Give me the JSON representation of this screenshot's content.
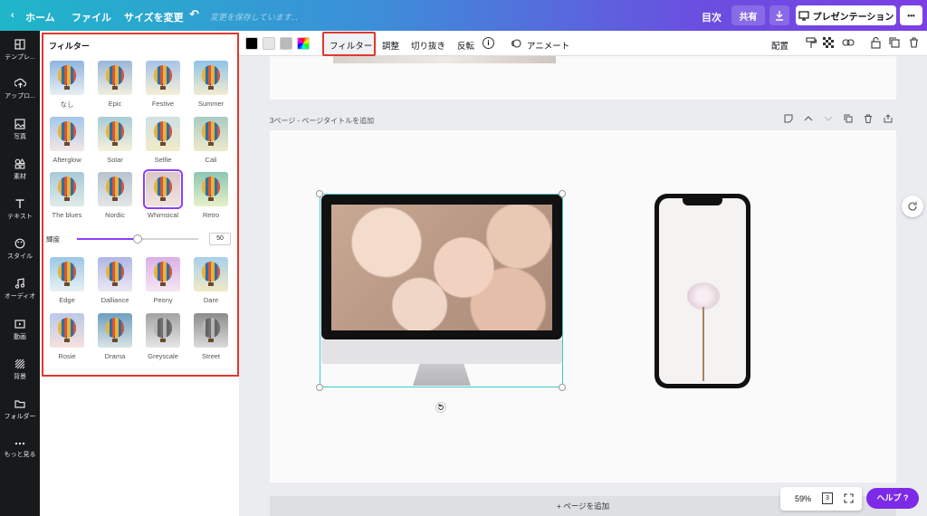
{
  "topbar": {
    "home": "ホーム",
    "file": "ファイル",
    "resize": "サイズを変更",
    "saving": "変更を保存しています...",
    "toc": "目次",
    "share": "共有",
    "present": "プレゼンテーション",
    "more": "•••"
  },
  "sidebar": {
    "items": [
      {
        "label": "テンプレ...",
        "icon": "template-icon"
      },
      {
        "label": "アップロ...",
        "icon": "upload-icon"
      },
      {
        "label": "写真",
        "icon": "photo-icon"
      },
      {
        "label": "素材",
        "icon": "elements-icon"
      },
      {
        "label": "テキスト",
        "icon": "text-icon"
      },
      {
        "label": "スタイル",
        "icon": "style-icon"
      },
      {
        "label": "オーディオ",
        "icon": "audio-icon"
      },
      {
        "label": "動画",
        "icon": "video-icon"
      },
      {
        "label": "背景",
        "icon": "background-icon"
      },
      {
        "label": "フォルダー",
        "icon": "folder-icon"
      },
      {
        "label": "もっと見る",
        "icon": "more-icon"
      }
    ]
  },
  "panel": {
    "title": "フィルター",
    "filters_top": [
      "なし",
      "Epic",
      "Festive",
      "Summer",
      "Afterglow",
      "Solar",
      "Selfie",
      "Cali",
      "The blues",
      "Nordic",
      "Whimsical",
      "Retro"
    ],
    "brightness_label": "輝度",
    "brightness_value": "50",
    "filters_bottom": [
      "Edge",
      "Dalliance",
      "Peony",
      "Dare",
      "Rosie",
      "Drama",
      "Greyscale",
      "Street"
    ],
    "selected": "Whimsical"
  },
  "toolbar": {
    "filter": "フィルター",
    "adjust": "調整",
    "crop": "切り抜き",
    "flip": "反転",
    "info": "i",
    "animate": "アニメート",
    "position": "配置",
    "colors": [
      "#000000",
      "#e6e6e6",
      "#b9b9b9"
    ]
  },
  "canvas": {
    "page_title": "3ページ - ページタイトルを追加",
    "add_page": "+ ページを追加",
    "zoom": "59%",
    "page_count": "3",
    "help": "ヘルプ ?"
  }
}
